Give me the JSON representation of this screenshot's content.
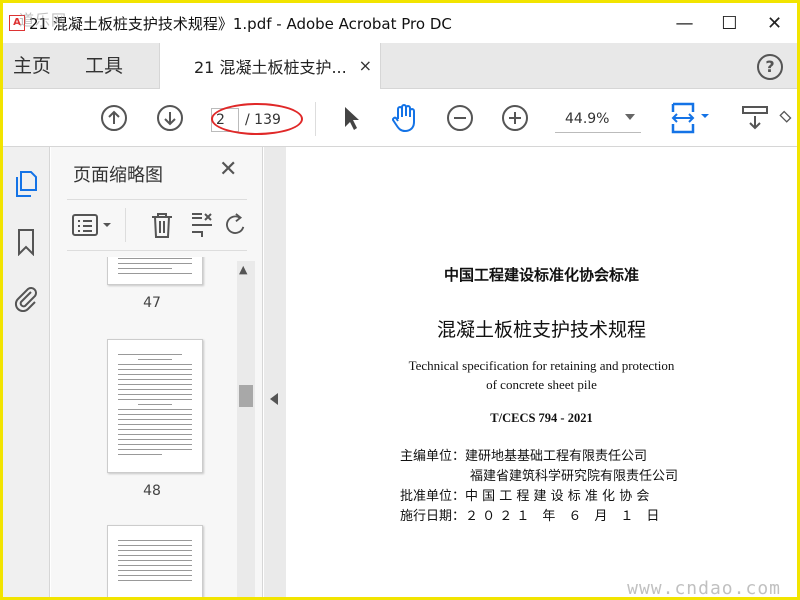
{
  "window": {
    "title": "21 混凝土板桩支护技术规程》1.pdf - Adobe Acrobat Pro DC",
    "app_icon": "acrobat-icon",
    "watermark_topleft": "道乐网",
    "minimize": "—",
    "maximize": "☐",
    "close": "✕"
  },
  "tabs": {
    "home": "主页",
    "tools": "工具",
    "document": "21 混凝土板桩支护...",
    "close": "×",
    "help": "?"
  },
  "toolbar": {
    "current_page": "2",
    "total_pages": "/ 139",
    "zoom": "44.9%",
    "highlight_color": "#e02828"
  },
  "sidebar": {
    "title": "页面缩略图",
    "close": "✕"
  },
  "thumbnails": {
    "pages": [
      "47",
      "48"
    ]
  },
  "document": {
    "org_standard": "中国工程建设标准化协会标准",
    "title_cn": "混凝土板桩支护技术规程",
    "title_en_1": "Technical specification for retaining and protection",
    "title_en_2": "of concrete sheet pile",
    "code": "T/CECS 794 - 2021",
    "chief_editor": "主编单位：建研地基基础工程有限责任公司",
    "chief_editor_2": "福建省建筑科学研究院有限责任公司",
    "approved_by": "批准单位：中 国 工 程 建 设 标 准 化 协 会",
    "effective_date": "施行日期：２ ０ ２ １　年　６　月　１　日"
  },
  "watermark_bottomright": "www.cndao.com",
  "colors": {
    "accent_blue": "#1473e6",
    "frame_yellow": "#f2e400"
  }
}
